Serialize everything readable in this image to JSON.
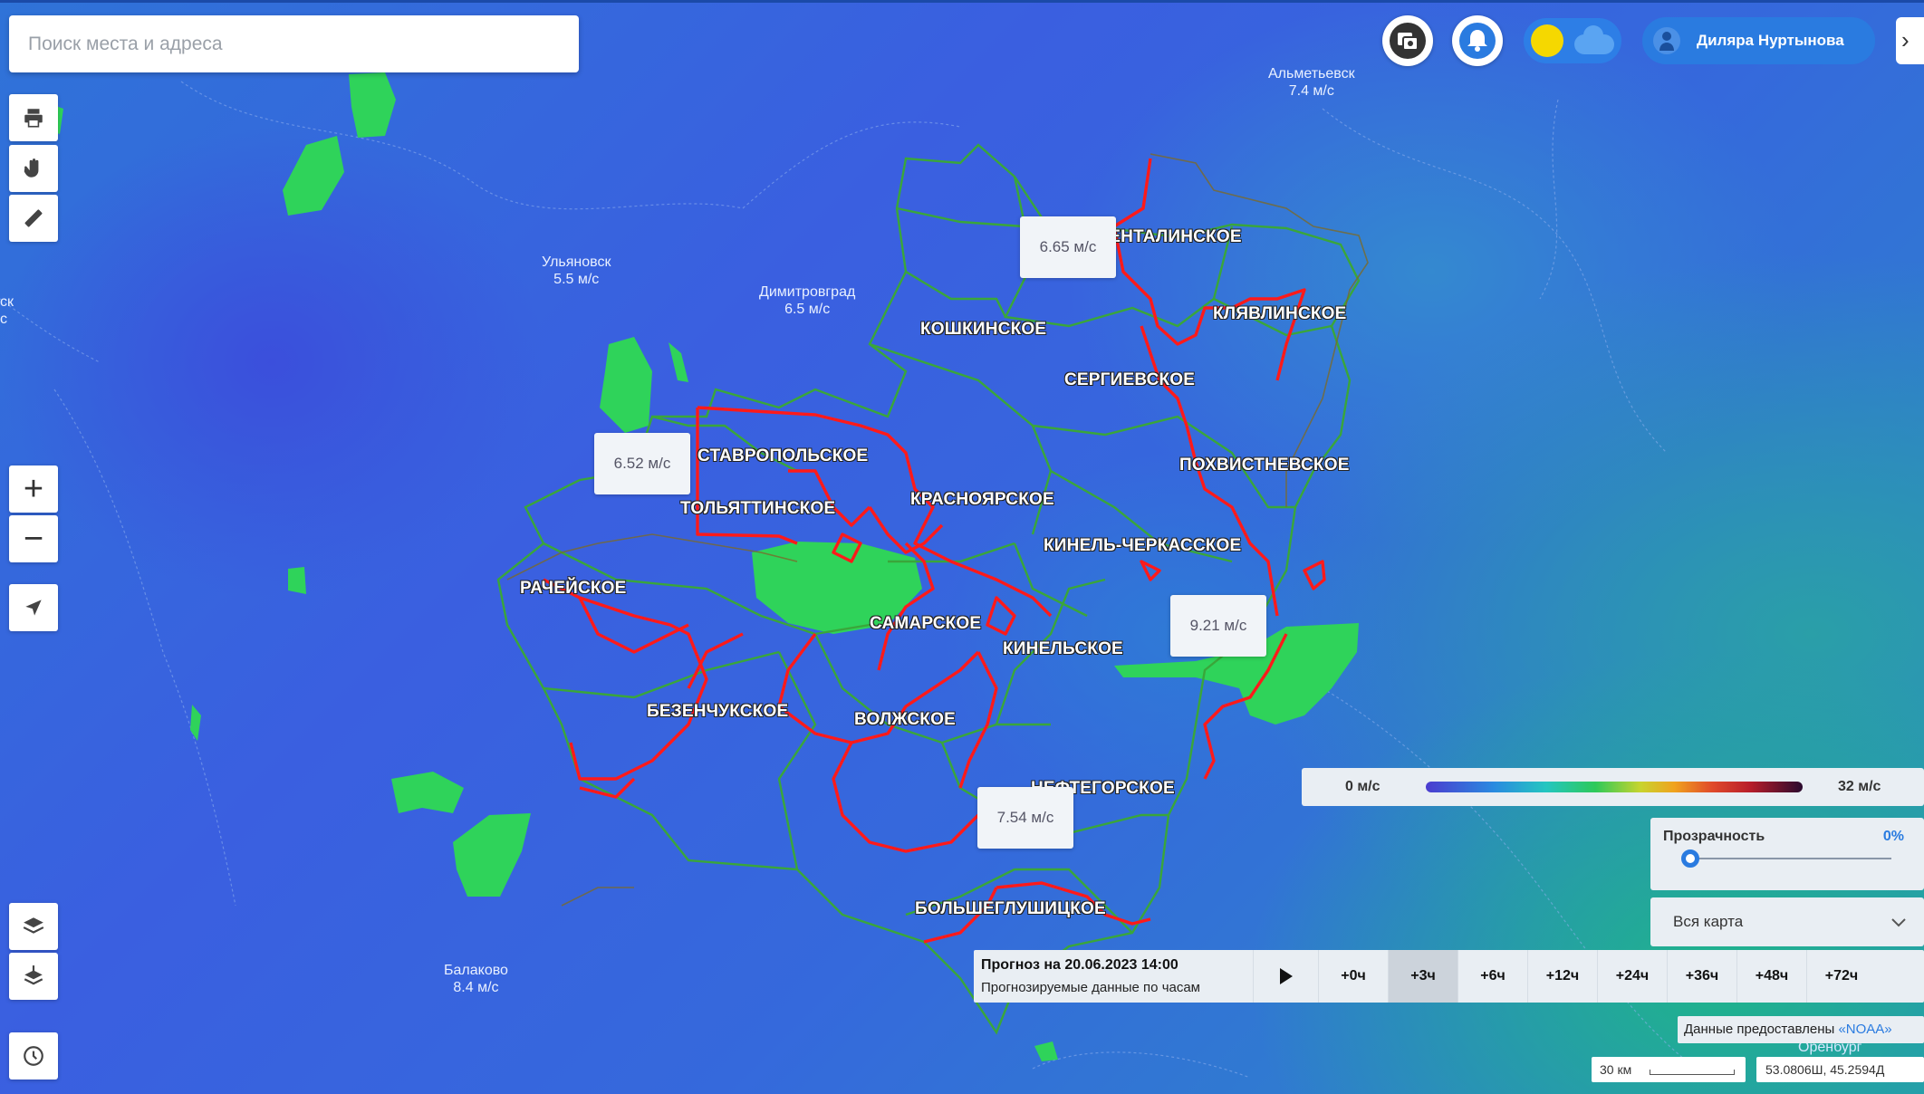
{
  "search": {
    "placeholder": "Поиск места и адреса"
  },
  "toolbar": {
    "print_icon": "printer-icon",
    "pan_icon": "hand-icon",
    "measure_icon": "ruler-icon",
    "zoom_in": "+",
    "zoom_out": "−",
    "locate_icon": "navigation-arrow-icon",
    "layers_icon": "layers-icon",
    "layers2_icon": "layers-download-icon",
    "history_icon": "clock-icon"
  },
  "header": {
    "user_name": "Диляра Нуртынова",
    "theme_toggle": "day-night-toggle",
    "side_tab_label": "›"
  },
  "cities": [
    {
      "name": "Альметьевск",
      "wind": "7.4 м/с"
    },
    {
      "name": "Ульяновск",
      "wind": "5.5 м/с"
    },
    {
      "name": "Димитровград",
      "wind": "6.5 м/с"
    },
    {
      "name": "Балаково",
      "wind": "8.4 м/с"
    },
    {
      "name": "ск",
      "wind": "с"
    },
    {
      "name": "Оренбург",
      "wind": ""
    }
  ],
  "regions": [
    "ШЕНТАЛИНСКОЕ",
    "КОШКИНСКОЕ",
    "КЛЯВЛИНСКОЕ",
    "СЕРГИЕВСКОЕ",
    "СТАВРОПОЛЬСКОЕ",
    "ПОХВИСТНЕВСКОЕ",
    "ТОЛЬЯТТИНСКОЕ",
    "КРАСНОЯРСКОЕ",
    "КИНЕЛЬ-ЧЕРКАССКОЕ",
    "РАЧЕЙСКОЕ",
    "САМАРСКОЕ",
    "КИНЕЛЬСКОЕ",
    "БЕЗЕНЧУКСКОЕ",
    "ВОЛЖСКОЕ",
    "НЕФТЕГОРСКОЕ",
    "БОЛЬШЕГЛУШИЦКОЕ"
  ],
  "wind_markers": [
    "6.65 м/с",
    "6.52 м/с",
    "9.21 м/с",
    "7.54 м/с"
  ],
  "legend": {
    "min": "0 м/с",
    "max": "32 м/с"
  },
  "transparency": {
    "title": "Прозрачность",
    "value": "0%",
    "level": 0
  },
  "area_select": {
    "value": "Вся карта"
  },
  "forecast": {
    "title": "Прогноз на 20.06.2023 14:00",
    "subtitle": "Прогнозируемые данные по часам",
    "steps": [
      "+0ч",
      "+3ч",
      "+6ч",
      "+12ч",
      "+24ч",
      "+36ч",
      "+48ч",
      "+72ч"
    ],
    "active_step": "+3ч"
  },
  "attribution": {
    "text": "Данные предоставлены ",
    "source": "«NOAA»"
  },
  "scale": {
    "label": "30 км"
  },
  "coordinates": {
    "value": "53.0806Ш, 45.2594Д"
  },
  "colors": {
    "accent": "#2a7be0",
    "boundary_red": "#ff1a1a",
    "boundary_green": "#3aa63a",
    "forest": "#2fd35a"
  }
}
